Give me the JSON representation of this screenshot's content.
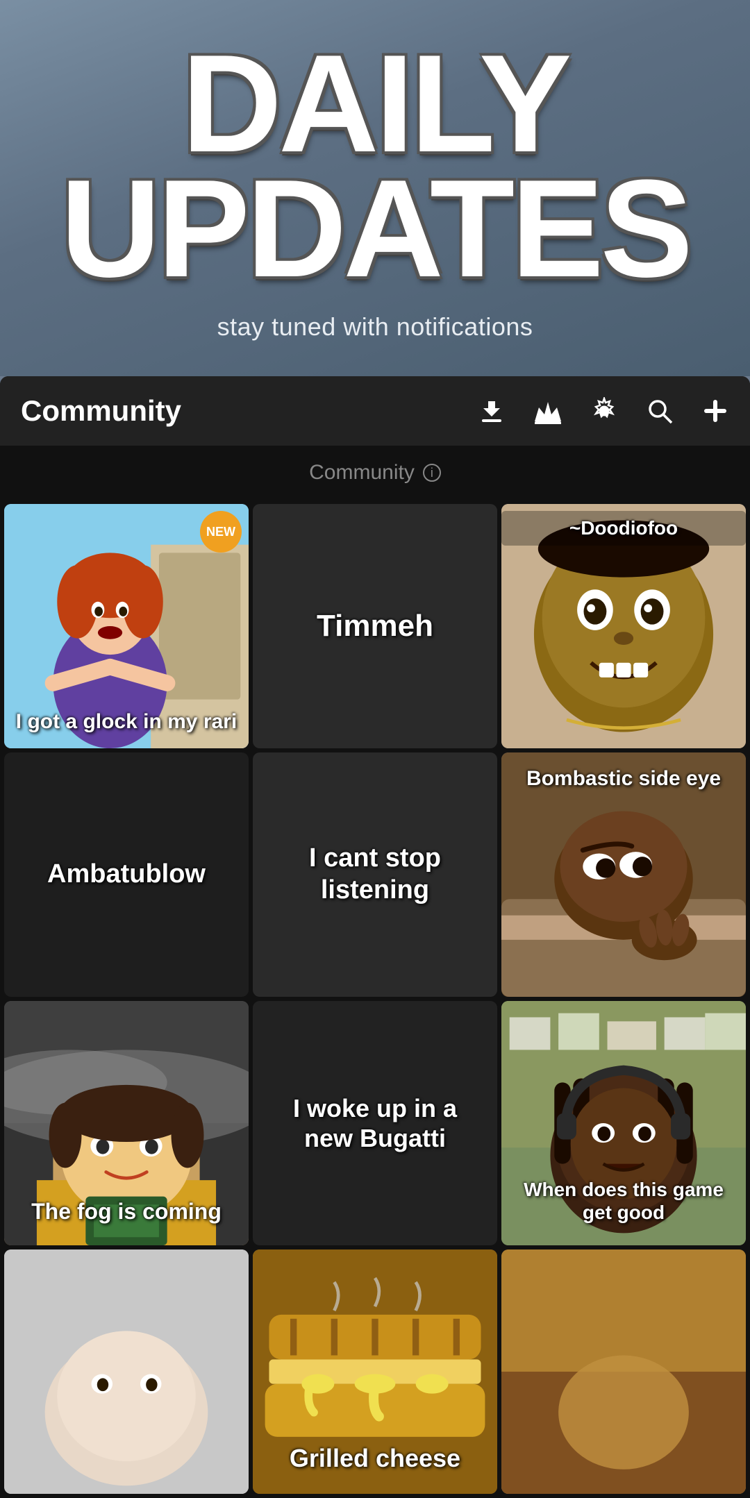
{
  "hero": {
    "line1": "DAILY",
    "line2": "UPDATES",
    "subtitle": "stay tuned with notifications"
  },
  "toolbar": {
    "title": "Community",
    "icons": {
      "download": "⬇",
      "crown": "♛",
      "settings": "⚙",
      "search": "🔍",
      "add": "+"
    }
  },
  "section": {
    "label": "Community",
    "info": "ℹ"
  },
  "grid": {
    "items": [
      {
        "id": "lois",
        "label": "I got a glock in my rari",
        "has_image": true,
        "is_new": true,
        "dark_bg": false
      },
      {
        "id": "timmeh",
        "label": "Timmeh",
        "has_image": false,
        "is_new": false,
        "dark_bg": true
      },
      {
        "id": "doodiofoo",
        "label": "~Doodiofoo",
        "has_image": true,
        "is_new": false,
        "dark_bg": false
      },
      {
        "id": "ambatublow",
        "label": "Ambatublow",
        "has_image": false,
        "is_new": false,
        "dark_bg": true
      },
      {
        "id": "icant",
        "label": "I cant stop listening",
        "has_image": false,
        "is_new": false,
        "dark_bg": true
      },
      {
        "id": "bombastic",
        "label": "Bombastic side eye",
        "has_image": true,
        "is_new": false,
        "dark_bg": false
      },
      {
        "id": "fog",
        "label": "The fog is coming",
        "has_image": true,
        "is_new": false,
        "dark_bg": false
      },
      {
        "id": "bugatti",
        "label": "I woke up in a new Bugatti",
        "has_image": false,
        "is_new": false,
        "dark_bg": true
      },
      {
        "id": "whendoes",
        "label": "When does this game get good",
        "has_image": true,
        "is_new": false,
        "dark_bg": false
      },
      {
        "id": "last1",
        "label": "",
        "has_image": true,
        "is_new": false,
        "dark_bg": false
      },
      {
        "id": "grilled",
        "label": "Grilled cheese",
        "has_image": true,
        "is_new": false,
        "dark_bg": false
      },
      {
        "id": "last3",
        "label": "",
        "has_image": true,
        "is_new": false,
        "dark_bg": false
      }
    ]
  }
}
